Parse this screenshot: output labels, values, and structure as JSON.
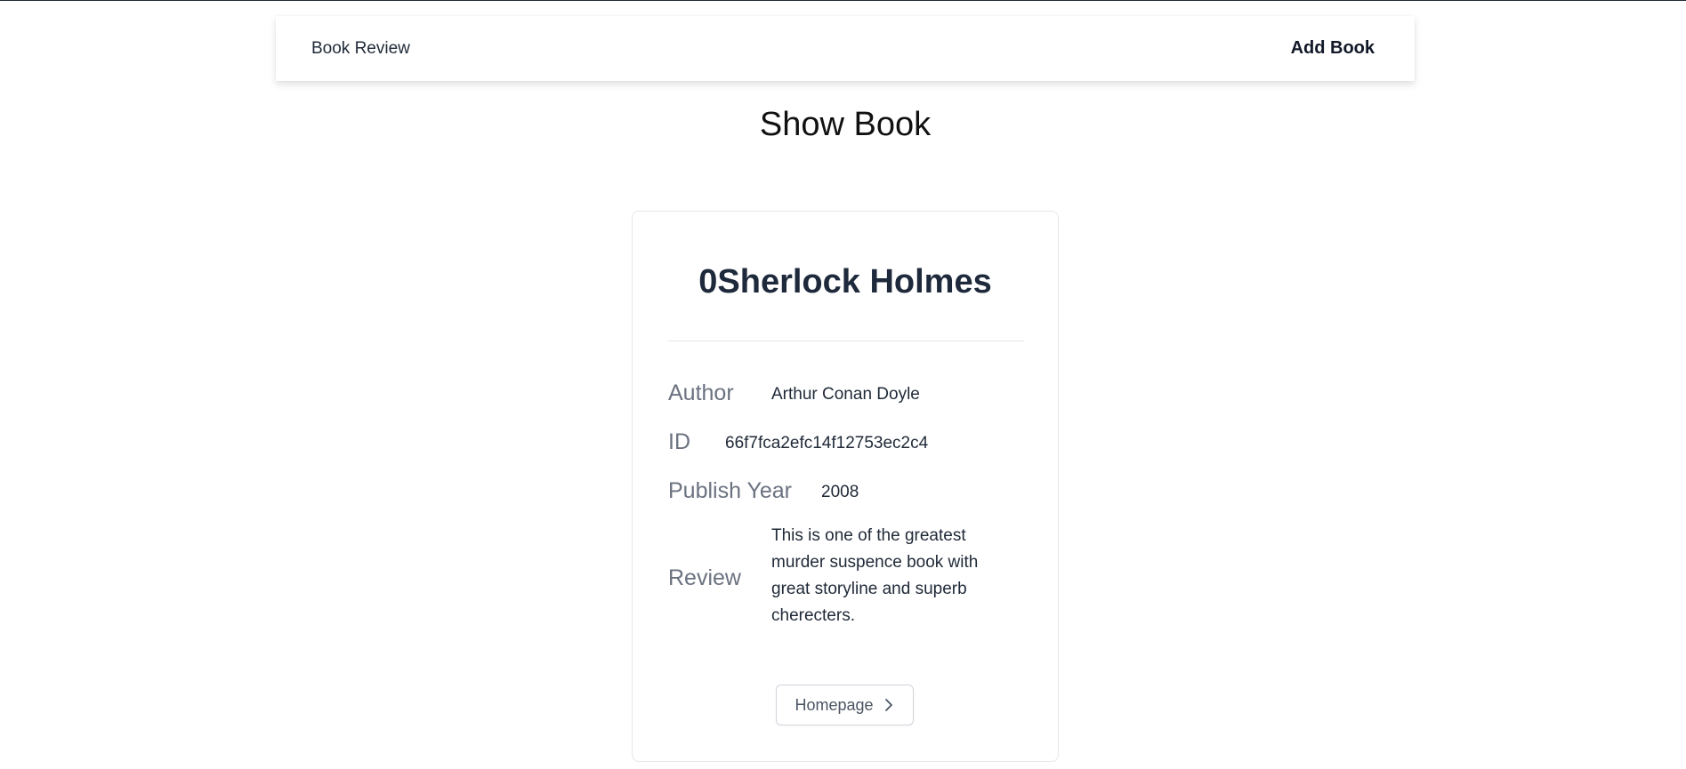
{
  "navbar": {
    "brand": "Book Review",
    "add_book": "Add Book"
  },
  "page": {
    "title": "Show Book"
  },
  "book": {
    "title": "0Sherlock Holmes",
    "fields": {
      "author_label": "Author",
      "author_value": "Arthur Conan Doyle",
      "id_label": "ID",
      "id_value": "66f7fca2efc14f12753ec2c4",
      "year_label": "Publish Year",
      "year_value": "2008",
      "review_label": "Review",
      "review_value": "This is one of the greatest murder suspence book with great storyline and superb cherecters."
    }
  },
  "actions": {
    "homepage_label": "Homepage",
    "homepage_icon": "chevron-right-icon"
  }
}
